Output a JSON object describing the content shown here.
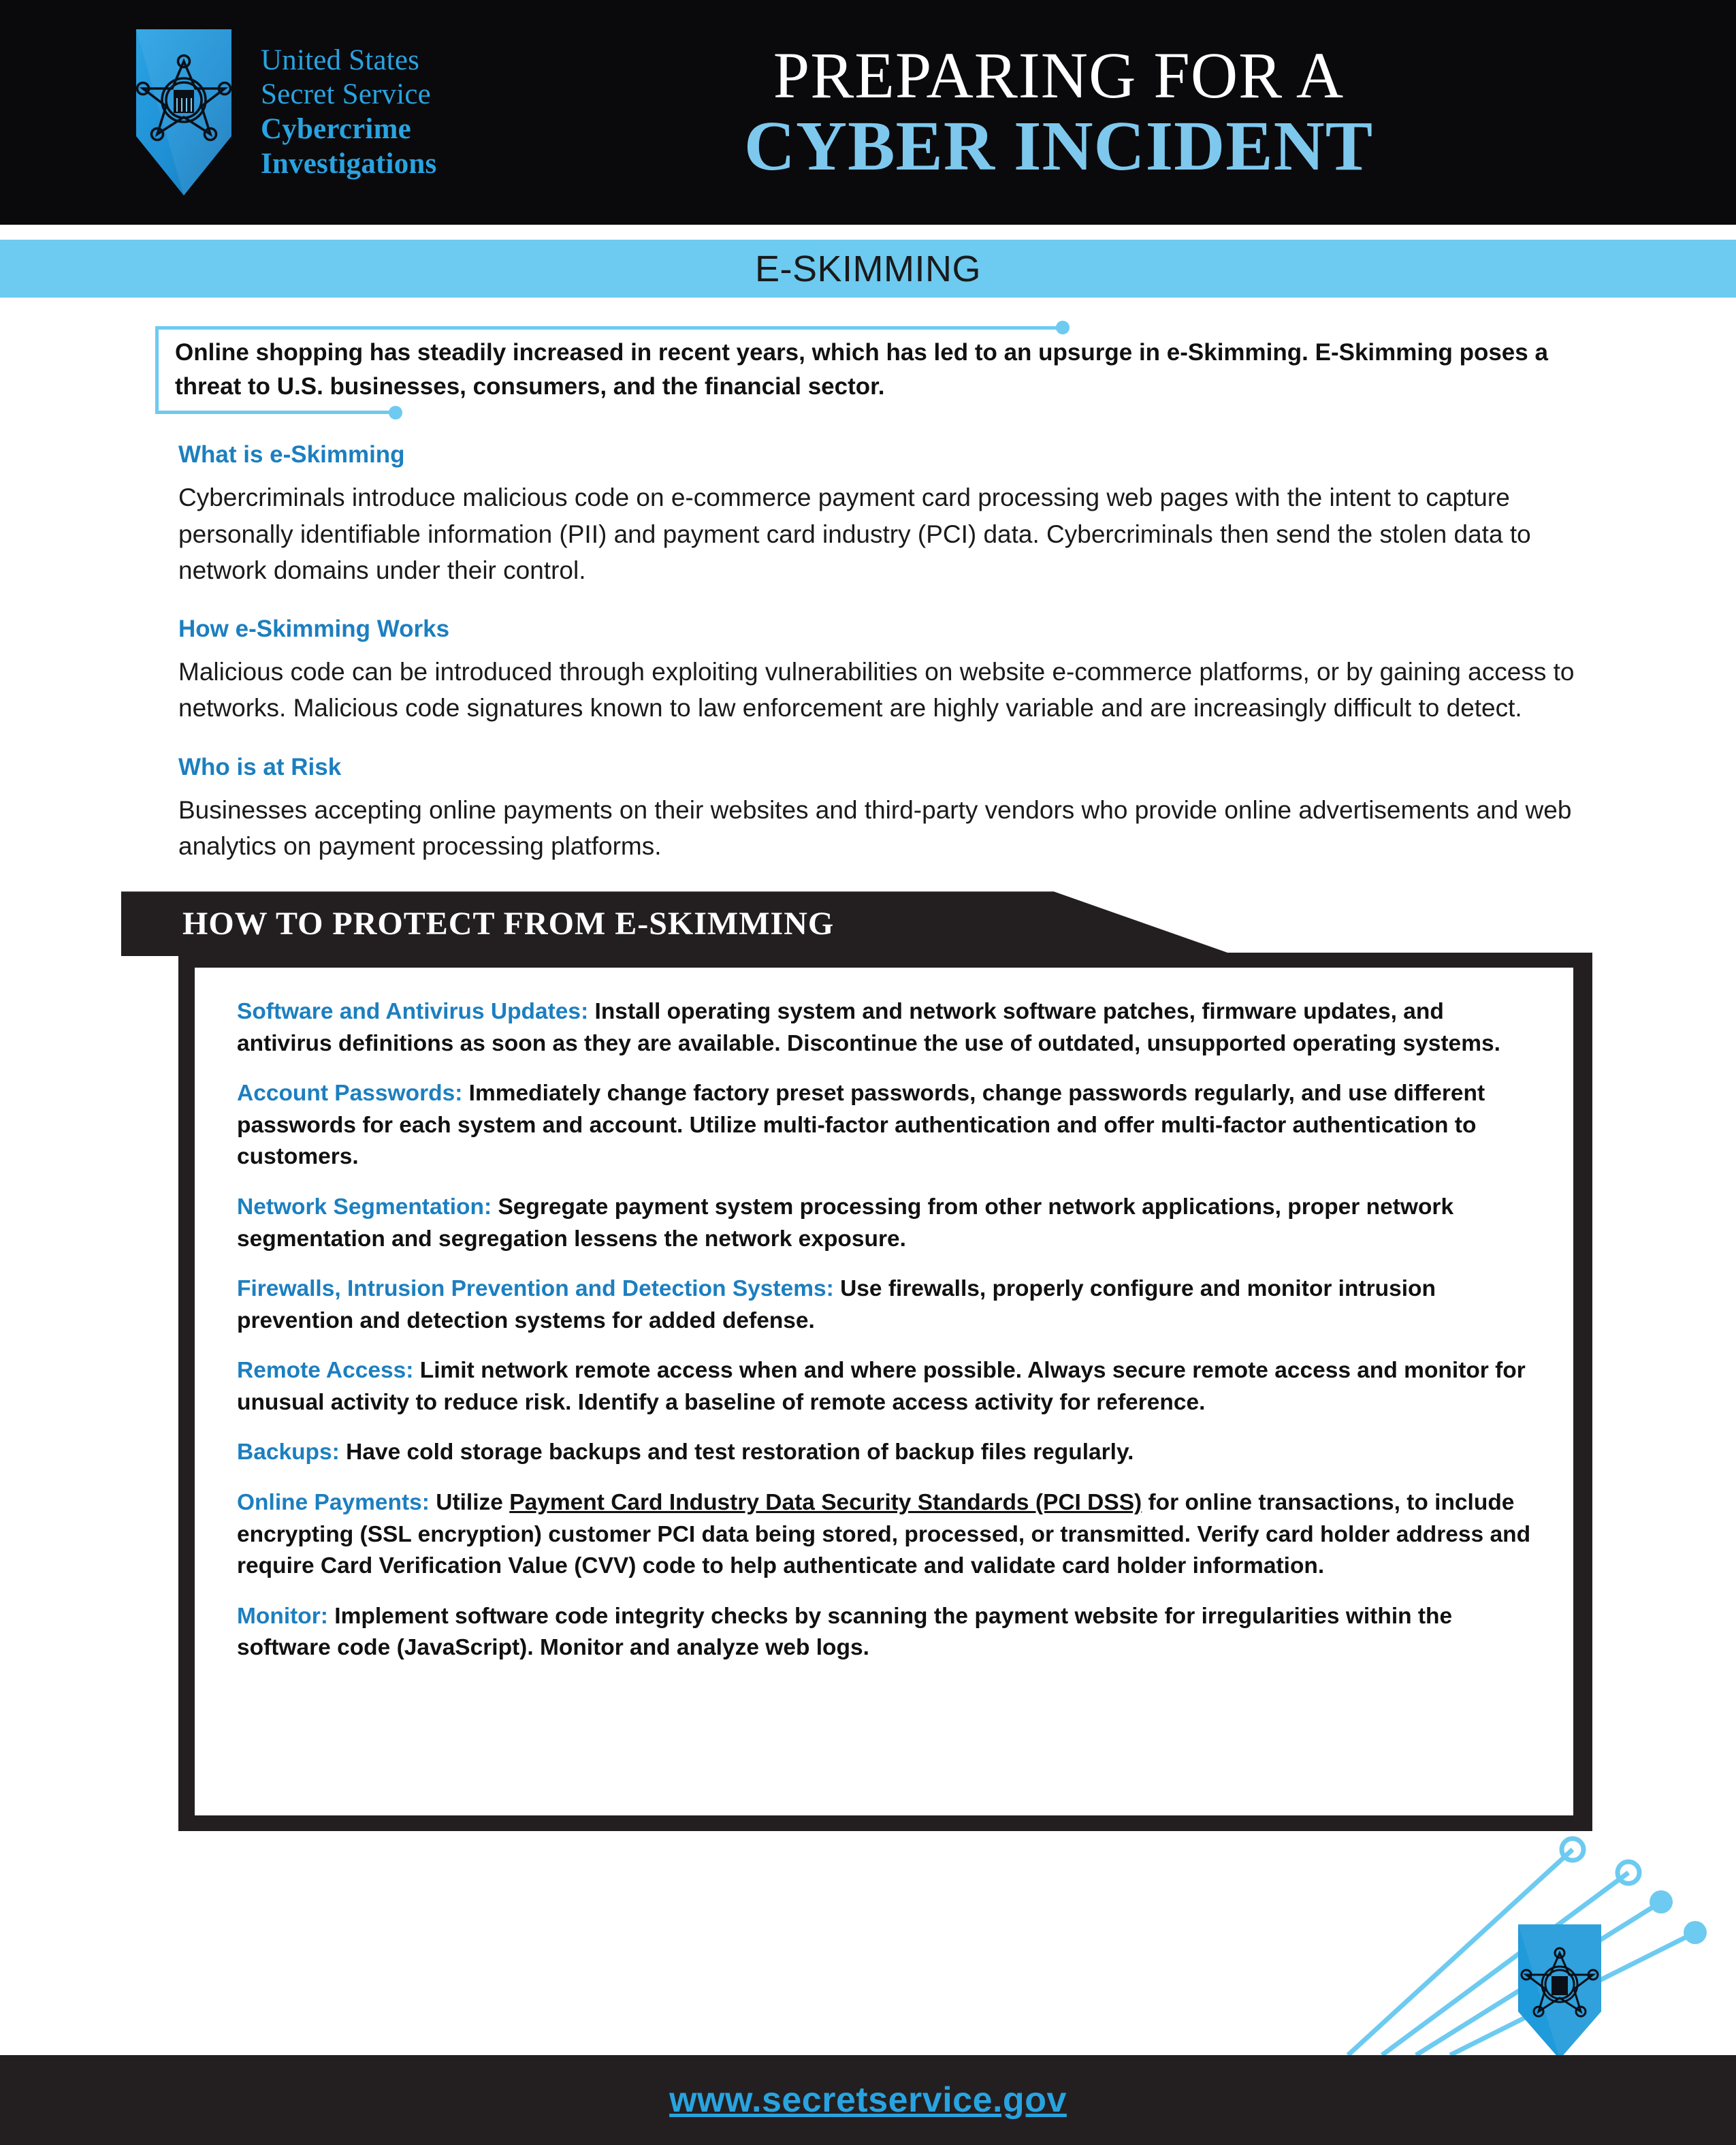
{
  "header": {
    "agency_lines": [
      "United States",
      "Secret Service",
      "Cybercrime",
      "Investigations"
    ],
    "title_line1": "PREPARING FOR A",
    "title_line2": "CYBER INCIDENT",
    "logo_name": "usss-star-shield-logo"
  },
  "section_banner": {
    "label": "E-SKIMMING",
    "background": "#6dcaf0"
  },
  "intro": {
    "text": "Online shopping has steadily increased in recent years, which has led to an upsurge in e-Skimming. E-Skimming poses a threat to U.S. businesses, consumers, and the financial sector."
  },
  "sections": [
    {
      "heading": "What is e-Skimming",
      "body": "Cybercriminals introduce malicious code on e-commerce payment card processing web pages with the intent to capture personally identifiable information (PII) and payment card industry (PCI) data. Cybercriminals then send the stolen data to network domains under their control."
    },
    {
      "heading": "How e-Skimming Works",
      "body": "Malicious code can be introduced through exploiting vulnerabilities on website e-commerce platforms, or by gaining access to networks. Malicious code signatures known to law enforcement are highly variable and are increasingly difficult to detect."
    },
    {
      "heading": "Who is at Risk",
      "body": "Businesses accepting online payments on their websites and third-party vendors who provide online advertisements and web analytics on payment processing platforms."
    }
  ],
  "protect": {
    "banner_title": "HOW TO PROTECT FROM E-SKIMMING",
    "tips": [
      {
        "label": "Software and Antivirus Updates:",
        "body": " Install operating system and network software patches, firmware updates, and antivirus definitions as soon as they are available. Discontinue the use of outdated, unsupported operating systems."
      },
      {
        "label": "Account Passwords:",
        "body": " Immediately change factory preset passwords, change passwords regularly, and use different passwords for each system and account. Utilize multi-factor authentication and offer multi-factor authentication to customers."
      },
      {
        "label": "Network Segmentation:",
        "body": " Segregate payment system processing from other network applications, proper network segmentation and segregation lessens the network exposure."
      },
      {
        "label": "Firewalls, Intrusion Prevention and Detection Systems:",
        "body": " Use firewalls, properly configure and monitor intrusion  prevention and detection systems for added defense."
      },
      {
        "label": "Remote Access:",
        "body": " Limit network remote access when and where possible. Always secure remote access and monitor for unusual activity to reduce risk. Identify a baseline of remote access activity for reference."
      },
      {
        "label": "Backups:",
        "body": " Have cold storage backups and test restoration of backup files regularly."
      },
      {
        "label": "Online Payments:",
        "body_pre": " Utilize ",
        "body_underline": "Payment Card Industry Data Security Standards (PCI DSS)",
        "body_post": " for online transactions, to include encrypting (SSL encryption) customer PCI data being stored, processed, or transmitted. Verify card holder address and require Card Verification Value (CVV) code to help authenticate and validate card holder information."
      },
      {
        "label": "Monitor:",
        "body": " Implement software code integrity checks by scanning the payment website for irregularities within the software code (JavaScript). Monitor and analyze web logs."
      }
    ]
  },
  "footer": {
    "url": "www.secretservice.gov",
    "logo_name": "usss-star-shield-logo",
    "circuit_name": "circuit-trace-decoration"
  },
  "colors": {
    "accent_blue": "#29a3e0",
    "light_blue": "#6dcaf0",
    "heading_blue": "#1c7fc0",
    "title_blue": "#7ec8ee",
    "dark": "#231f20",
    "black": "#0a0a0d"
  }
}
